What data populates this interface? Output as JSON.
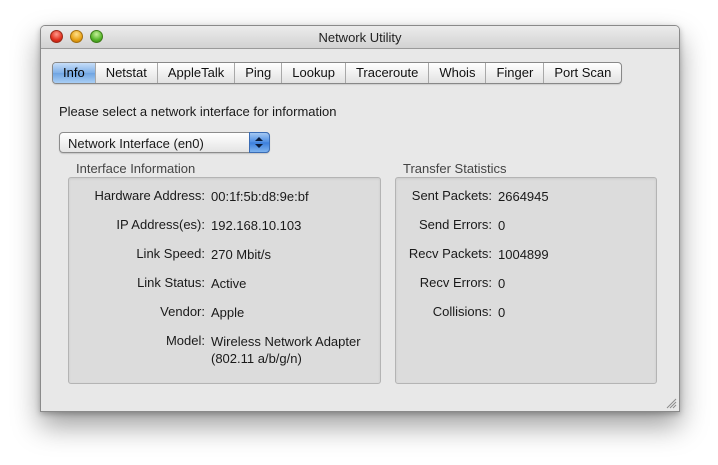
{
  "window": {
    "title": "Network Utility"
  },
  "tabs": [
    {
      "label": "Info",
      "selected": true
    },
    {
      "label": "Netstat"
    },
    {
      "label": "AppleTalk"
    },
    {
      "label": "Ping"
    },
    {
      "label": "Lookup"
    },
    {
      "label": "Traceroute"
    },
    {
      "label": "Whois"
    },
    {
      "label": "Finger"
    },
    {
      "label": "Port Scan"
    }
  ],
  "info": {
    "prompt": "Please select a network interface for information",
    "interface_select": {
      "value": "Network Interface (en0)"
    },
    "interface_information": {
      "title": "Interface Information",
      "rows": [
        {
          "label": "Hardware Address:",
          "value": "00:1f:5b:d8:9e:bf"
        },
        {
          "label": "IP Address(es):",
          "value": "192.168.10.103"
        },
        {
          "label": "Link Speed:",
          "value": "270 Mbit/s"
        },
        {
          "label": "Link Status:",
          "value": "Active"
        },
        {
          "label": "Vendor:",
          "value": "Apple"
        },
        {
          "label": "Model:",
          "value": "Wireless Network Adapter",
          "value2": "(802.11 a/b/g/n)"
        }
      ]
    },
    "transfer_statistics": {
      "title": "Transfer Statistics",
      "rows": [
        {
          "label": "Sent Packets:",
          "value": "2664945"
        },
        {
          "label": "Send Errors:",
          "value": "0"
        },
        {
          "label": "Recv Packets:",
          "value": "1004899"
        },
        {
          "label": "Recv Errors:",
          "value": "0"
        },
        {
          "label": "Collisions:",
          "value": "0"
        }
      ]
    }
  }
}
